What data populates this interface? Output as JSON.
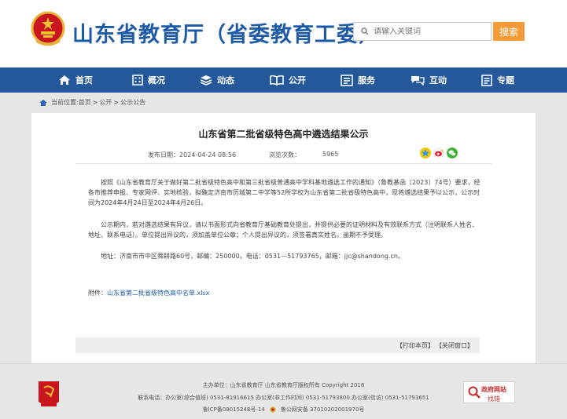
{
  "header": {
    "site_title": "山东省教育厅（省委教育工委）",
    "search": {
      "placeholder": "请输入关键词",
      "button_label": "搜索"
    }
  },
  "nav": {
    "items": [
      {
        "label": "首页",
        "icon": "home-icon"
      },
      {
        "label": "概况",
        "icon": "building-icon"
      },
      {
        "label": "动态",
        "icon": "layers-icon"
      },
      {
        "label": "公开",
        "icon": "book-icon"
      },
      {
        "label": "服务",
        "icon": "service-icon"
      },
      {
        "label": "互动",
        "icon": "chat-icon"
      },
      {
        "label": "专题",
        "icon": "document-icon"
      }
    ]
  },
  "breadcrumb": {
    "prefix": "当前位置:",
    "items": [
      "首页",
      "公开",
      "公示公告"
    ],
    "separator": ">"
  },
  "article": {
    "title": "山东省第二批省级特色高中遴选结果公示",
    "publish_label": "发布日期：",
    "publish_date": "2024-04-24 08:56",
    "views_label": "浏览次数：",
    "views": "5965",
    "paragraphs": [
      "按照《山东省教育厅关于做好第二批省级特色高中和第三批省级普通高中学科基地遴选工作的通知》（鲁教基函〔2023〕74号）要求，经各市推荐申报、专家网评、实地核验，拟确定济南市历城第二中学等52所学校为山东省第二批省级特色高中，现将遴选结果予以公示，公示时间为2024年4月24日至2024年4月26日。",
      "公示期内，若对遴选结果有异议，请以书面形式向省教育厅基础教育处提出，并提供必要的证明材料及有效联系方式（注明联系人姓名、地址、联系电话）。单位提出异议的，须加盖单位公章；个人提出异议的，须签署真实姓名。逾期不予受理。",
      "地址：济南市市中区舜耕路60号，邮编：250000。电话：0531—51793765，邮箱：jjc@shandong.cn。"
    ],
    "attachment_label": "附件：",
    "attachment_name": "山东省第二批省级特色高中名单.xlsx",
    "print_label": "【打印本页】",
    "close_label": "【关闭窗口】"
  },
  "footer": {
    "sponsor": "主办单位：山东省教育厅  山东省教育厅版权所有  Copyright 2018",
    "contact": "联系电话：办公室(综合值班) 0531-81916615  办公室(非工作时间) 0531-51793800  办公室(信访) 0531-51793651",
    "icp": "鲁ICP备09015248号-14",
    "police": "鲁公网安备 37010202001970号",
    "gov_label_1": "政府网站",
    "gov_label_2": "找错"
  },
  "colors": {
    "brand_blue": "#1d5ba6",
    "nav_blue": "#24589a",
    "search_orange": "#f29b38",
    "gov_red": "#c32b2b"
  }
}
